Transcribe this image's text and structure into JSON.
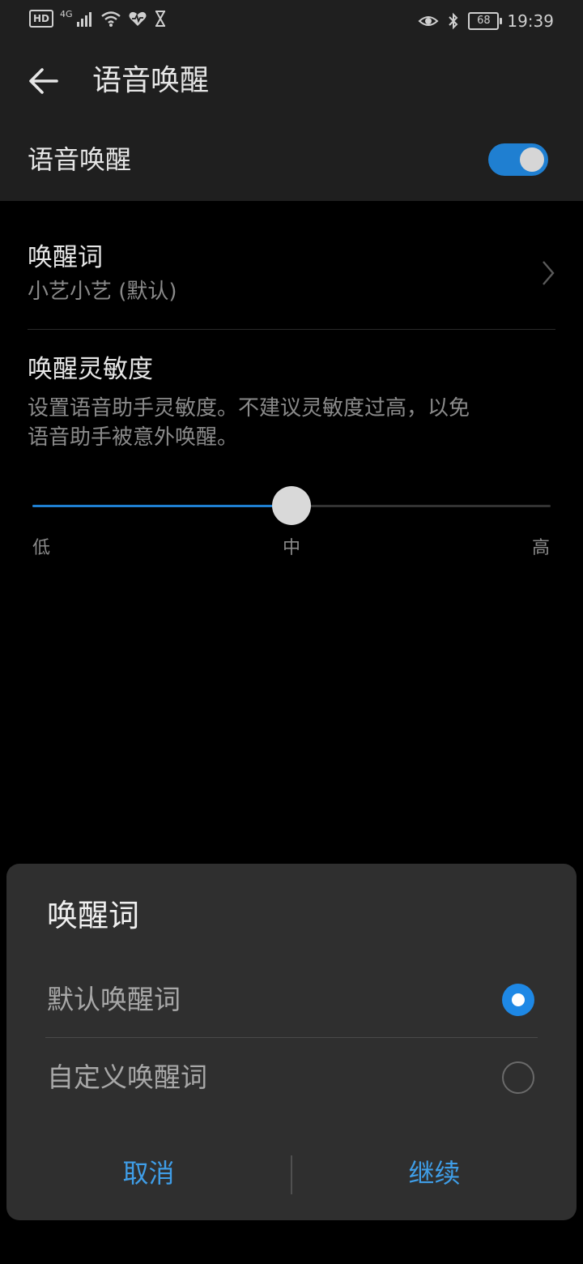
{
  "status_bar": {
    "hd_badge": "HD",
    "network": "4G",
    "battery_level": "68",
    "time": "19:39"
  },
  "app_bar": {
    "title": "语音唤醒"
  },
  "voice_wake": {
    "label": "语音唤醒",
    "enabled": true
  },
  "wake_word": {
    "title": "唤醒词",
    "value": "小艺小艺 (默认)"
  },
  "sensitivity": {
    "title": "唤醒灵敏度",
    "description_line1": "设置语音助手灵敏度。不建议灵敏度过高，以免",
    "description_line2": "语音助手被意外唤醒。",
    "level": 0.5,
    "labels": {
      "low": "低",
      "mid": "中",
      "high": "高"
    }
  },
  "dialog": {
    "title": "唤醒词",
    "options": [
      {
        "label": "默认唤醒词",
        "selected": true
      },
      {
        "label": "自定义唤醒词",
        "selected": false
      }
    ],
    "cancel_label": "取消",
    "continue_label": "继续"
  },
  "colors": {
    "accent": "#1f7fd1",
    "radio_selected": "#1e88e5",
    "button_text": "#3f9ee8",
    "dialog_bg": "#2f2f2f"
  }
}
